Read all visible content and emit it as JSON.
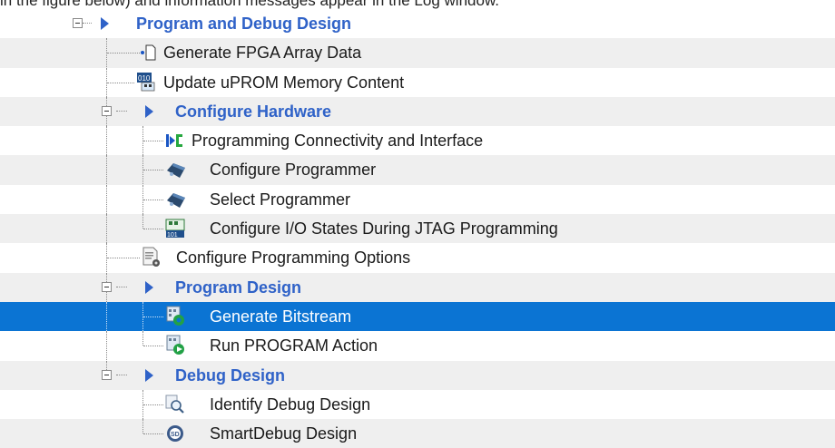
{
  "caption": "in the figure below) and information messages appear in the Log window.",
  "tree": {
    "group_program_debug": "Program and Debug Design",
    "item_generate_fpga": "Generate FPGA Array Data",
    "item_update_uprom": "Update uPROM Memory Content",
    "group_configure_hw": "Configure Hardware",
    "item_prog_connectivity": "Programming Connectivity and Interface",
    "item_configure_programmer": "Configure Programmer",
    "item_select_programmer": "Select Programmer",
    "item_configure_io": "Configure I/O States During JTAG Programming",
    "item_configure_options": "Configure Programming Options",
    "group_program_design": "Program Design",
    "item_generate_bitstream": "Generate Bitstream",
    "item_run_program": "Run PROGRAM Action",
    "group_debug_design": "Debug Design",
    "item_identify_debug": "Identify Debug Design",
    "item_smartdebug": "SmartDebug Design"
  },
  "icons": {
    "generate_fpga": "document-icon",
    "update_uprom": "memory-binary-icon",
    "prog_connectivity": "connectivity-icon",
    "configure_programmer": "programmer-icon",
    "select_programmer": "programmer-icon",
    "configure_io": "io-states-icon",
    "configure_options": "options-gear-icon",
    "generate_bitstream": "bitstream-icon",
    "run_program": "run-action-icon",
    "identify_debug": "magnifier-icon",
    "smartdebug": "smartdebug-icon"
  },
  "colors": {
    "selection": "#0b74d3",
    "group_text": "#2f62c8",
    "alt_row": "#efefef"
  }
}
